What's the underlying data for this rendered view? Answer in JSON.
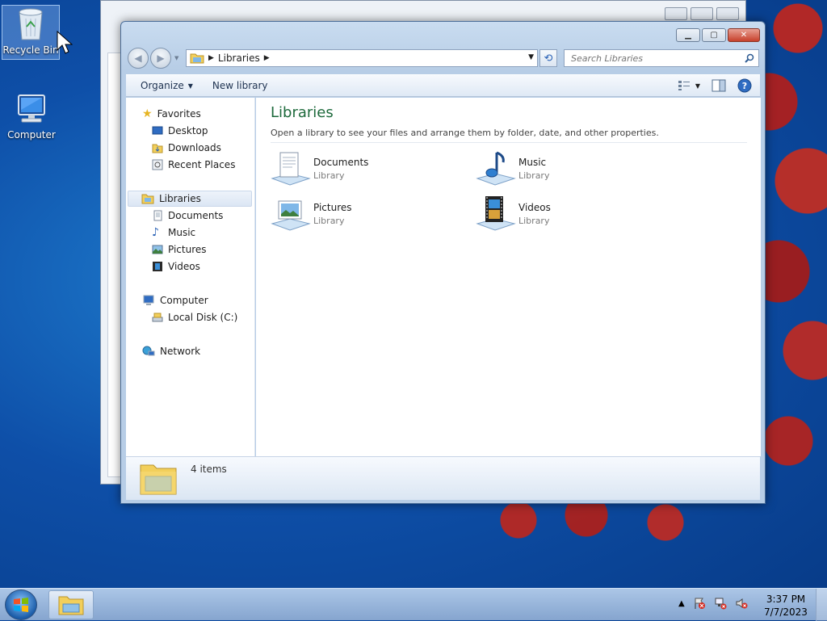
{
  "desktop": {
    "icons": [
      {
        "label": "Recycle Bin",
        "icon": "recycle-bin-icon"
      },
      {
        "label": "Computer",
        "icon": "computer-icon"
      }
    ]
  },
  "window": {
    "address": {
      "location": "Libraries"
    },
    "search": {
      "placeholder": "Search Libraries"
    },
    "toolbar": {
      "organize": "Organize",
      "new_library": "New library"
    },
    "nav": {
      "favorites": "Favorites",
      "desktop": "Desktop",
      "downloads": "Downloads",
      "recent_places": "Recent Places",
      "libraries": "Libraries",
      "documents": "Documents",
      "music": "Music",
      "pictures": "Pictures",
      "videos": "Videos",
      "computer": "Computer",
      "local_disk": "Local Disk (C:)",
      "network": "Network"
    },
    "content": {
      "title": "Libraries",
      "description": "Open a library to see your files and arrange them by folder, date, and other properties.",
      "items": [
        {
          "name": "Documents",
          "type": "Library"
        },
        {
          "name": "Music",
          "type": "Library"
        },
        {
          "name": "Pictures",
          "type": "Library"
        },
        {
          "name": "Videos",
          "type": "Library"
        }
      ]
    },
    "details": {
      "count": "4 items"
    }
  },
  "taskbar": {
    "time": "3:37 PM",
    "date": "7/7/2023"
  },
  "colors": {
    "title_green": "#1e6a3c",
    "close_red": "#c7402b",
    "accent_blue": "#2a62b6"
  }
}
